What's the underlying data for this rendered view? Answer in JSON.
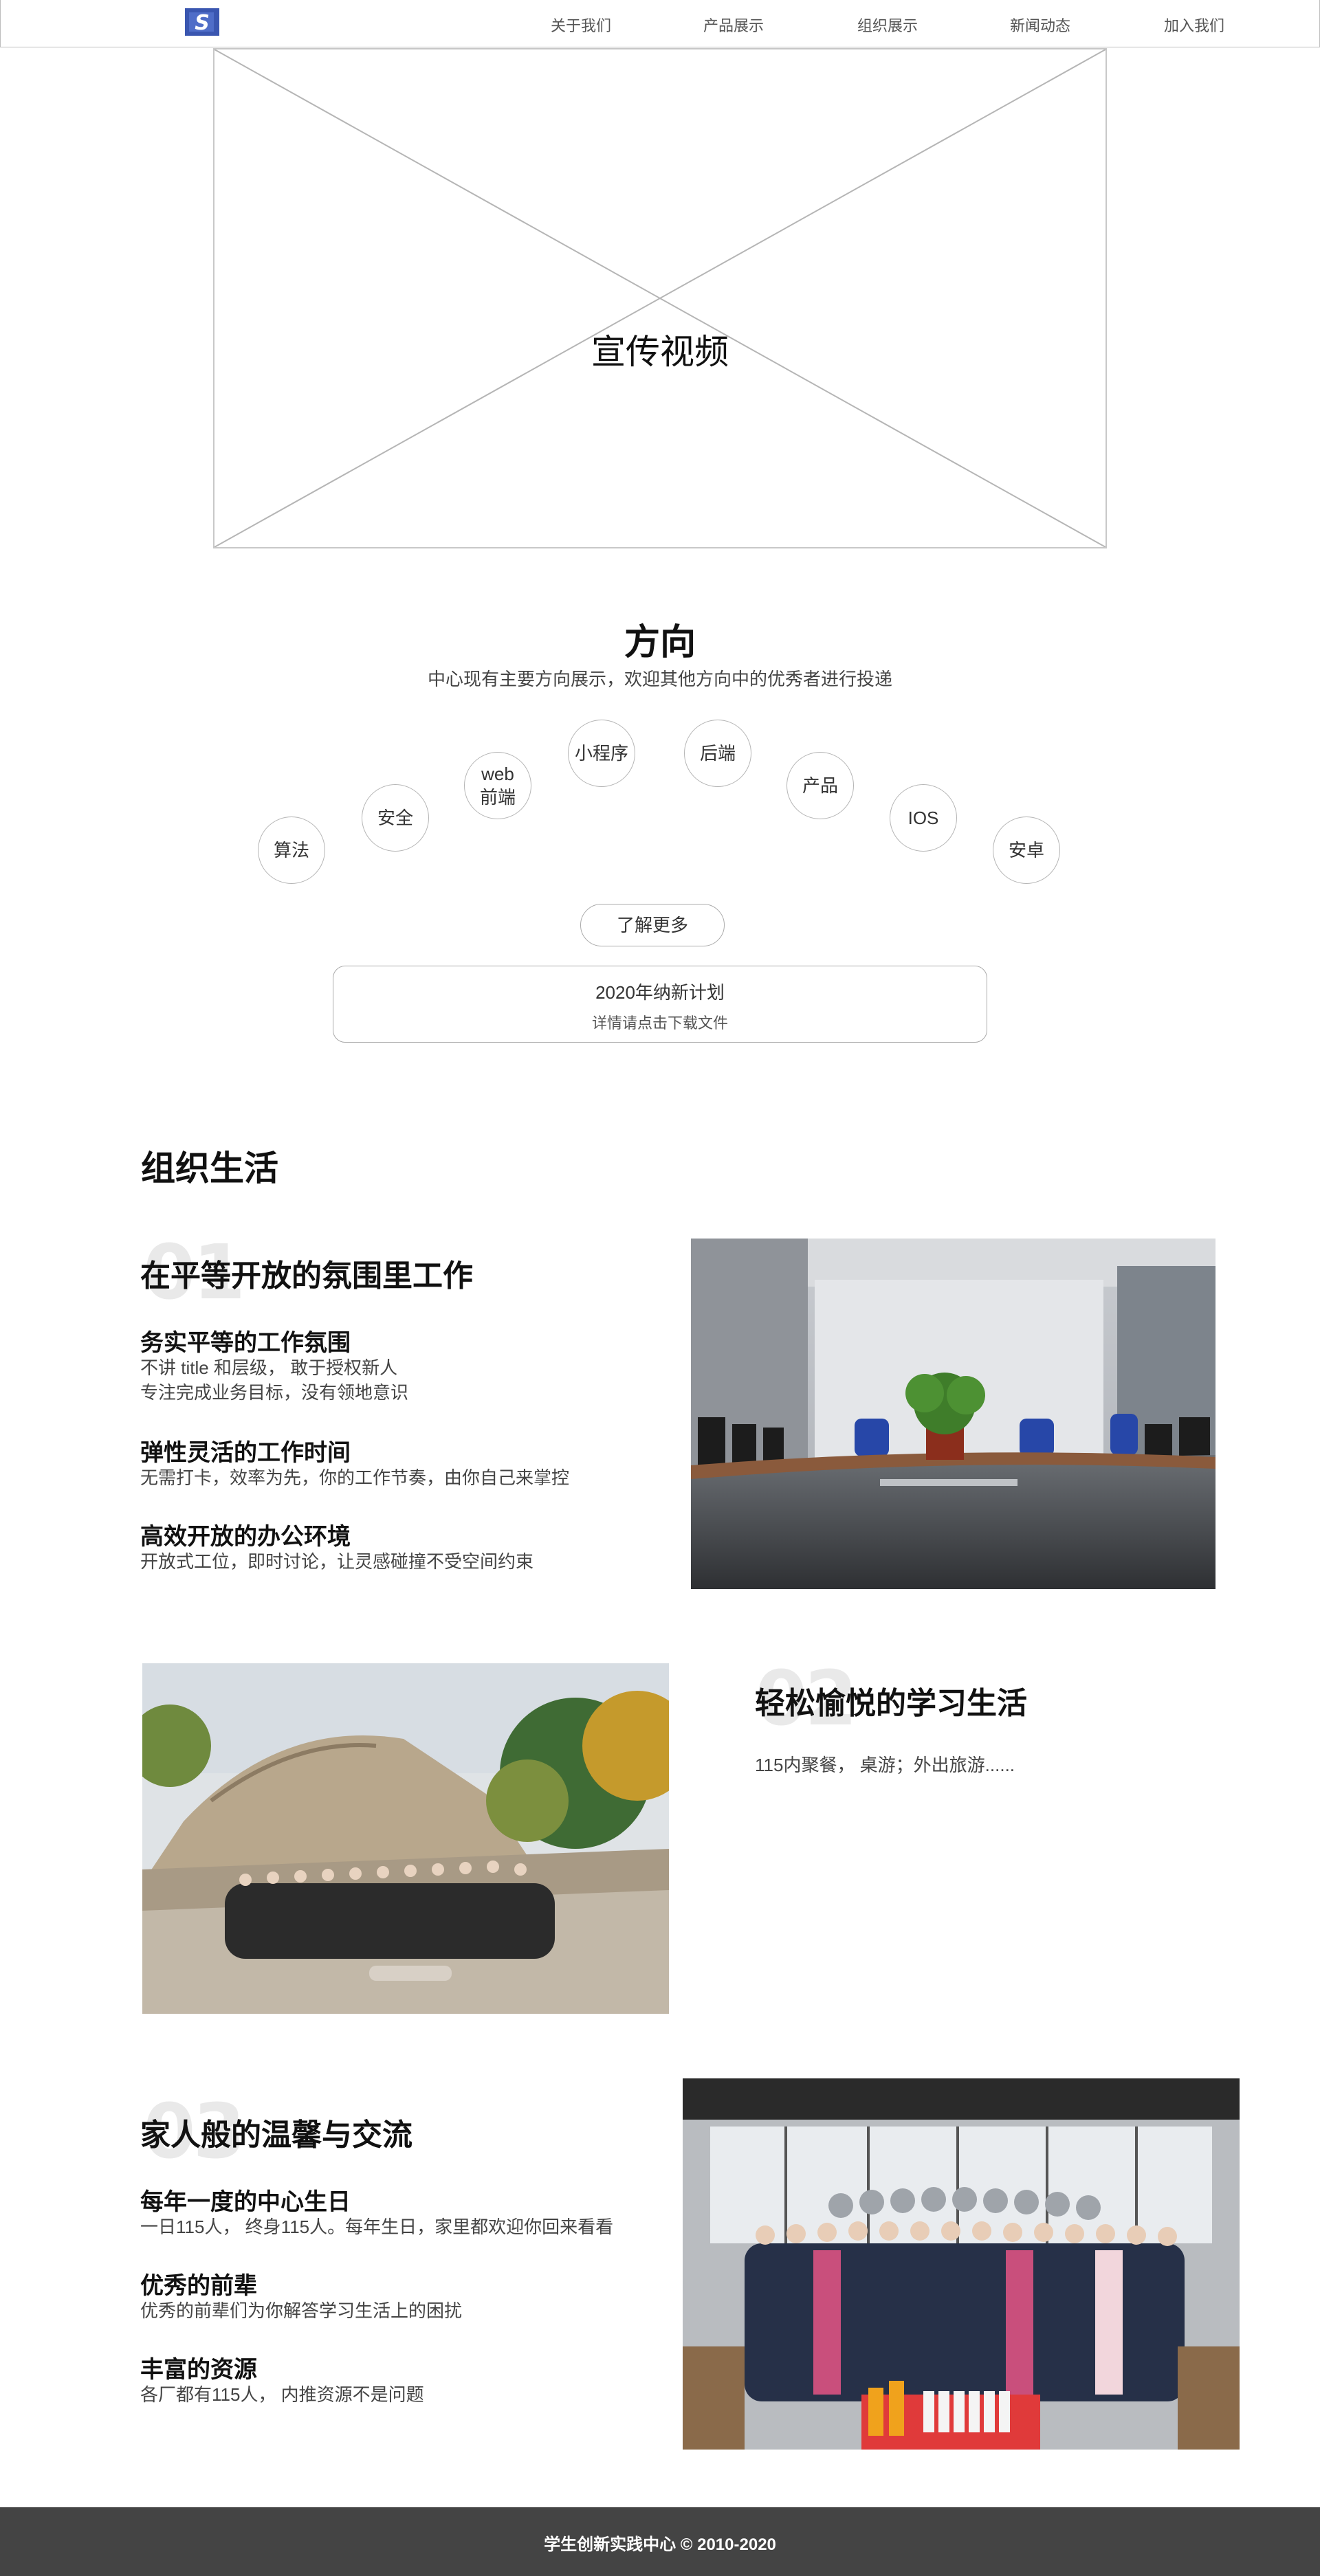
{
  "nav": {
    "items": [
      {
        "label": "关于我们"
      },
      {
        "label": "产品展示"
      },
      {
        "label": "组织展示"
      },
      {
        "label": "新闻动态"
      },
      {
        "label": "加入我们"
      }
    ]
  },
  "video": {
    "title": "宣传视频"
  },
  "direction": {
    "title": "方向",
    "subtitle": "中心现有主要方向展示，欢迎其他方向中的优秀者进行投递",
    "items": [
      {
        "label": "算法"
      },
      {
        "label": "安全"
      },
      {
        "label": "web\n前端"
      },
      {
        "label": "小程序"
      },
      {
        "label": "后端"
      },
      {
        "label": "产品"
      },
      {
        "label": "IOS"
      },
      {
        "label": "安卓"
      }
    ],
    "learn_more": "了解更多",
    "plan": {
      "title": "2020年纳新计划",
      "subtitle": "详情请点击下载文件"
    }
  },
  "org": {
    "title": "组织生活",
    "blocks": [
      {
        "num": "01",
        "title": "在平等开放的氛围里工作",
        "items": [
          {
            "title": "务实平等的工作氛围",
            "desc1": "不讲 title 和层级， 敢于授权新人",
            "desc2": "专注完成业务目标，没有领地意识"
          },
          {
            "title": "弹性灵活的工作时间",
            "desc1": "无需打卡，效率为先，你的工作节奏，由你自己来掌控"
          },
          {
            "title": "高效开放的办公环境",
            "desc1": "开放式工位，即时讨论，让灵感碰撞不受空间约束"
          }
        ]
      },
      {
        "num": "02",
        "title": "轻松愉悦的学习生活",
        "desc": "115内聚餐， 桌游；外出旅游......"
      },
      {
        "num": "03",
        "title": "家人般的温馨与交流",
        "items": [
          {
            "title": "每年一度的中心生日",
            "desc1": "一日115人， 终身115人。每年生日，家里都欢迎你回来看看"
          },
          {
            "title": "优秀的前辈",
            "desc1": "优秀的前辈们为你解答学习生活上的困扰"
          },
          {
            "title": "丰富的资源",
            "desc1": "各厂都有115人， 内推资源不是问题"
          }
        ]
      }
    ]
  },
  "footer": {
    "text": "学生创新实践中心 © 2010-2020"
  },
  "colors": {
    "logo": "#3a56b0",
    "footer_bg": "#444444"
  }
}
